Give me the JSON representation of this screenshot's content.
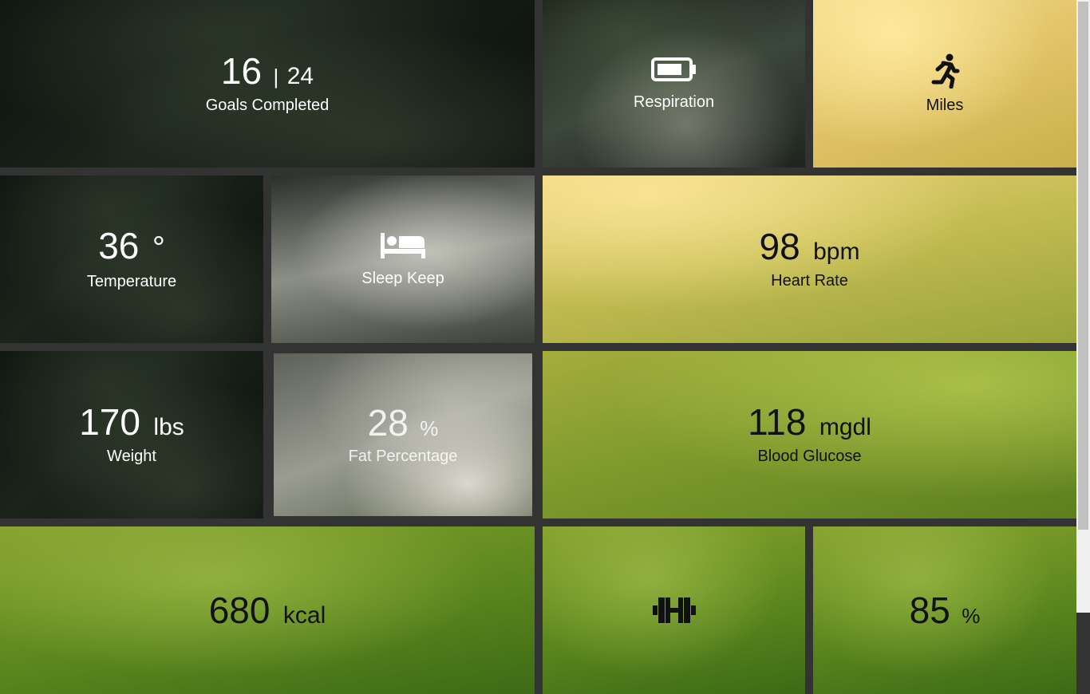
{
  "tiles": {
    "goals": {
      "value": "16",
      "separator": "|",
      "total": "24",
      "label": "Goals Completed"
    },
    "respiration": {
      "icon": "battery-icon",
      "label": "Respiration"
    },
    "miles": {
      "icon": "running-icon",
      "label": "Miles"
    },
    "temperature": {
      "value": "36",
      "unit": "°",
      "label": "Temperature"
    },
    "sleep": {
      "icon": "bed-icon",
      "label": "Sleep Keep"
    },
    "heart_rate": {
      "value": "98",
      "unit": "bpm",
      "label": "Heart Rate"
    },
    "weight": {
      "value": "170",
      "unit": "lbs",
      "label": "Weight"
    },
    "fat": {
      "value": "28",
      "unit": "%",
      "label": "Fat Percentage"
    },
    "glucose": {
      "value": "118",
      "unit": "mgdl",
      "label": "Blood Glucose"
    },
    "calories": {
      "value": "680",
      "unit": "kcal"
    },
    "workout": {
      "icon": "dumbbell-icon"
    },
    "percent": {
      "value": "85",
      "unit": "%"
    }
  },
  "colors": {
    "gap": "#333333",
    "text_light": "#ffffff",
    "text_dark": "#111111"
  }
}
